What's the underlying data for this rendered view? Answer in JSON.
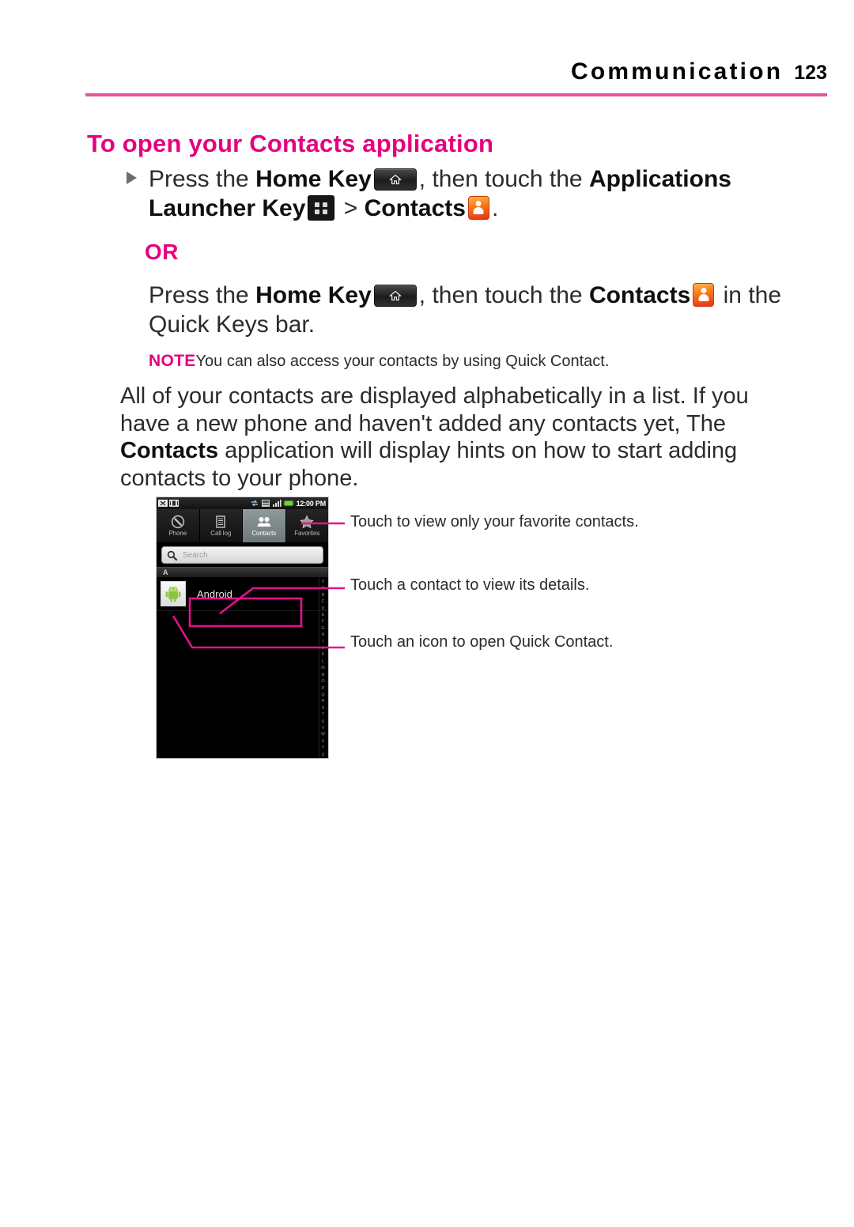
{
  "header": {
    "chapter_title": "Communication",
    "page_number": "123",
    "rule_color": "#e8559d"
  },
  "section": {
    "heading": "To open your Contacts application",
    "heading_color": "#e6007e"
  },
  "step_primary": {
    "text_1": "Press the ",
    "bold_1": "Home Key",
    "home_key_icon": "home-key-icon",
    "text_2": ", then touch the ",
    "bold_2": "Applications Launcher Key",
    "launcher_key_icon": "apps-launcher-key-icon",
    "text_3": " > ",
    "bold_3": "Contacts",
    "contacts_icon": "contacts-app-icon",
    "text_4": "."
  },
  "or_label": "OR",
  "step_alternate": {
    "text_1": "Press the ",
    "bold_1": "Home Key",
    "home_key_icon": "home-key-icon",
    "text_2": ", then touch the ",
    "bold_2": "Contacts",
    "contacts_icon": "contacts-app-icon",
    "text_3": " in the Quick Keys bar."
  },
  "note": {
    "label": "NOTE",
    "text": "You can also access your contacts by using Quick Contact."
  },
  "paragraph": {
    "part_1": "All of your contacts are displayed alphabetically in a list. If you have a new phone and haven't added any contacts yet, The ",
    "bold": "Contacts",
    "part_2": " application will display hints on how to start adding contacts to your phone."
  },
  "phone_screenshot": {
    "status_bar": {
      "time": "12:00 PM",
      "left_icons": [
        "silent-mode-icon",
        "vibrate-icon"
      ],
      "right_icons": [
        "sync-icon",
        "sd-card-icon",
        "signal-bars-icon",
        "battery-icon"
      ]
    },
    "tabs": [
      {
        "label": "Phone",
        "icon": "phone-handset-icon",
        "selected": false
      },
      {
        "label": "Call log",
        "icon": "call-log-list-icon",
        "selected": false
      },
      {
        "label": "Contacts",
        "icon": "contacts-group-icon",
        "selected": true
      },
      {
        "label": "Favorites",
        "icon": "star-icon",
        "selected": false
      }
    ],
    "search": {
      "placeholder": "Search",
      "icon": "search-icon"
    },
    "section_letter": "A",
    "contacts": [
      {
        "name": "Android",
        "avatar": "android-robot-avatar"
      }
    ],
    "alpha_index": [
      "#",
      "A",
      "B",
      "C",
      "D",
      "E",
      "F",
      "G",
      "H",
      "I",
      "J",
      "K",
      "L",
      "M",
      "N",
      "O",
      "P",
      "Q",
      "R",
      "S",
      "T",
      "U",
      "V",
      "W",
      "X",
      "Y",
      "Z"
    ]
  },
  "callouts": [
    {
      "text": "Touch to view only your favorite contacts."
    },
    {
      "text": "Touch a contact to view its details."
    },
    {
      "text": "Touch an icon to open Quick Contact."
    }
  ],
  "colors": {
    "accent_magenta": "#e6007e",
    "rule_pink": "#e8559d",
    "callout_line": "#e6128c"
  }
}
